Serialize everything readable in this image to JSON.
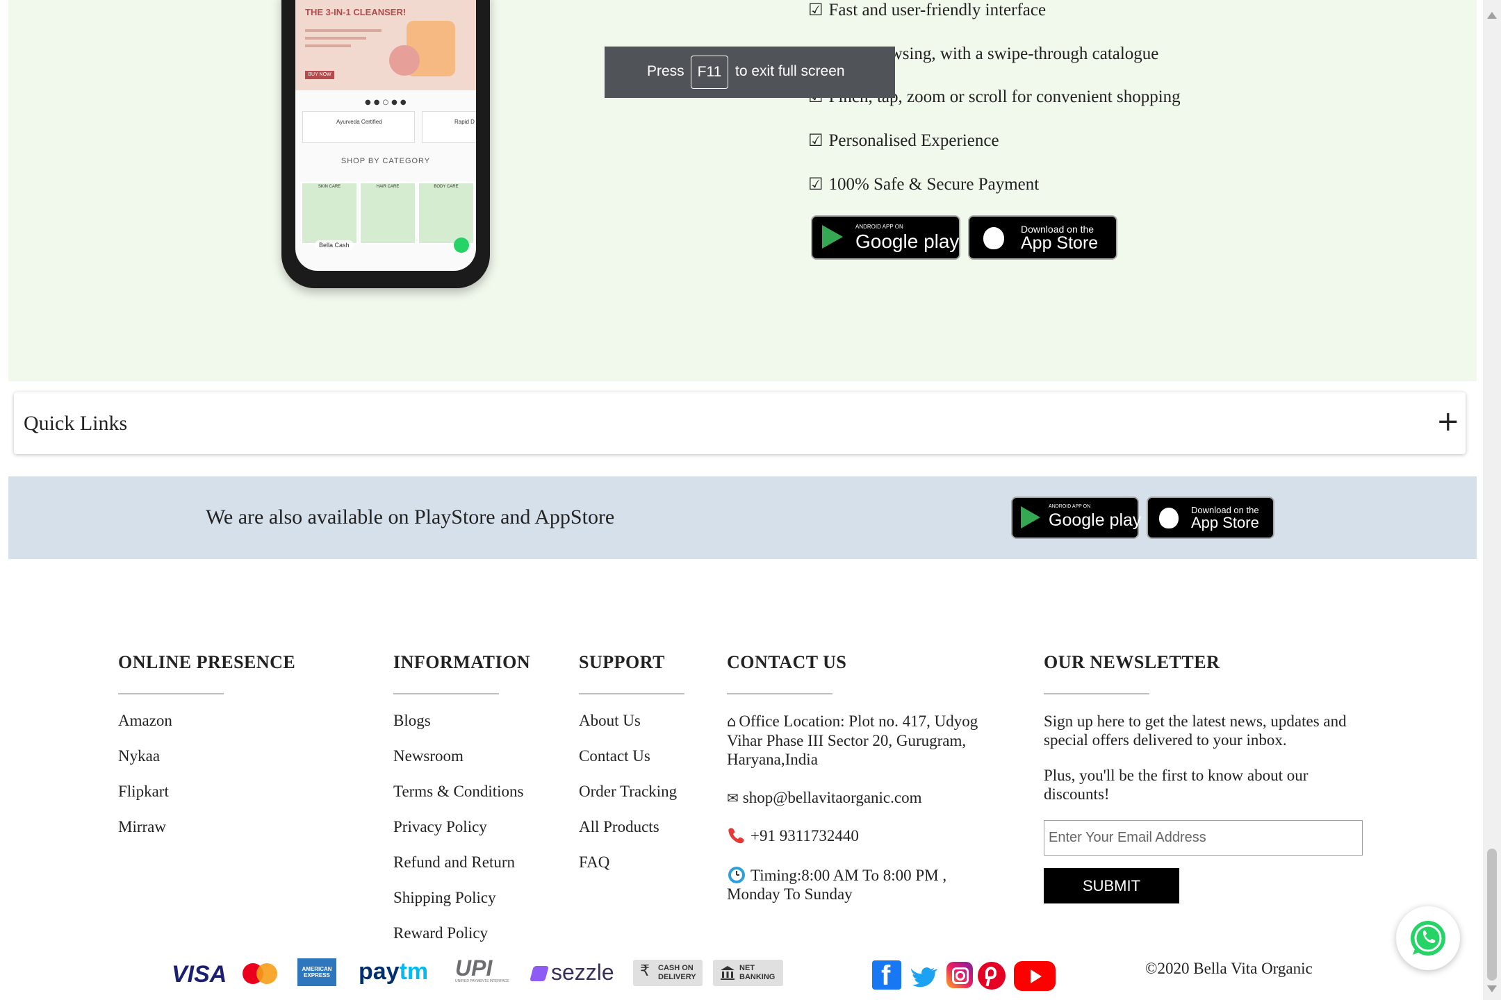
{
  "promo": {
    "phone": {
      "banner_title": "THE 3-IN-1 CLEANSER!",
      "buy_now": "BUY NOW",
      "card1": "Ayurveda Certified",
      "card2": "Rapid D",
      "shop_by_category": "SHOP BY CATEGORY",
      "tiles": [
        "SKIN CARE",
        "HAIR CARE",
        "BODY CARE"
      ],
      "bella_cash": "Bella Cash"
    },
    "features": [
      "Fast and user-friendly interface",
      "Easy browsing, with a swipe-through catalogue",
      "Pinch, tap, zoom or scroll for convenient shopping",
      "Personalised Experience",
      "100% Safe & Secure Payment"
    ],
    "checkbox_glyph": "☑",
    "google_play": {
      "small": "ANDROID APP ON",
      "big": "Google play"
    },
    "app_store": {
      "small": "Download on the",
      "big": "App Store"
    }
  },
  "toast": {
    "press": "Press",
    "key": "F11",
    "rest": "to exit full screen"
  },
  "quick_links": {
    "title": "Quick Links",
    "toggle": "+"
  },
  "availability": {
    "text": "We are also available on PlayStore and AppStore",
    "google_play": {
      "small": "ANDROID APP ON",
      "big": "Google play"
    },
    "app_store": {
      "small": "Download on the",
      "big": "App Store"
    }
  },
  "footer": {
    "online_presence": {
      "heading": "ONLINE PRESENCE",
      "links": [
        "Amazon",
        "Nykaa",
        "Flipkart",
        "Mirraw"
      ]
    },
    "information": {
      "heading": "INFORMATION",
      "links": [
        "Blogs",
        "Newsroom",
        "Terms & Conditions",
        "Privacy Policy",
        "Refund and Return",
        "Shipping Policy",
        "Reward Policy"
      ]
    },
    "support": {
      "heading": "SUPPORT",
      "links": [
        "About Us",
        "Contact Us",
        "Order Tracking",
        "All Products",
        "FAQ"
      ]
    },
    "contact": {
      "heading": "CONTACT US",
      "office_icon": "⌂",
      "office": "Office Location: Plot no. 417, Udyog Vihar Phase III Sector 20, Gurugram, Haryana,India",
      "mail_icon": "✉",
      "email": "shop@bellavitaorganic.com",
      "phone": "+91 9311732440",
      "timing": "Timing:8:00 AM To 8:00 PM , Monday To Sunday"
    },
    "newsletter": {
      "heading": "OUR NEWSLETTER",
      "text1": "Sign up here to get the latest news, updates and special offers delivered to your inbox.",
      "text2": "Plus, you'll be the first to know about our discounts!",
      "placeholder": "Enter Your Email Address",
      "submit": "SUBMIT"
    },
    "payments": {
      "visa": "VISA",
      "amex": "AMERICAN EXPRESS",
      "paytm_a": "pay",
      "paytm_b": "tm",
      "upi": "UPI",
      "upi_sub": "UNIFIED PAYMENTS INTERFACE",
      "sezzle": "sezzle",
      "cod_symbol": "₹",
      "cod": "CASH ON DELIVERY",
      "netbanking": "NET BANKING"
    },
    "social_glyphs": {
      "facebook": "f"
    },
    "copyright": "©2020 Bella Vita Organic"
  },
  "colors": {
    "promo_bg": "#f1f8ec",
    "avail_bg": "#d6e0ea",
    "toast_bg": "#505458",
    "whatsapp": "#25d366",
    "facebook": "#1877f2",
    "twitter": "#1da1f2",
    "pinterest": "#e60023",
    "youtube": "#ff0000"
  }
}
